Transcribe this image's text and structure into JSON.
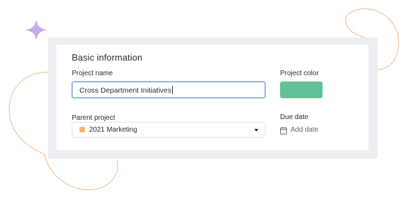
{
  "form": {
    "section_title": "Basic information",
    "project_name_label": "Project name",
    "project_name_value": "Cross Department Initiatives",
    "project_color_label": "Project color",
    "project_color_value": "#63c197",
    "parent_project_label": "Parent project",
    "parent_project_value": "2021 Marketing",
    "parent_project_color": "#f5b66a",
    "due_date_label": "Due date",
    "add_date_label": "Add date"
  },
  "decoration": {
    "sparkle_color": "#c9a9ec",
    "curve_color": "#f2b78a"
  }
}
